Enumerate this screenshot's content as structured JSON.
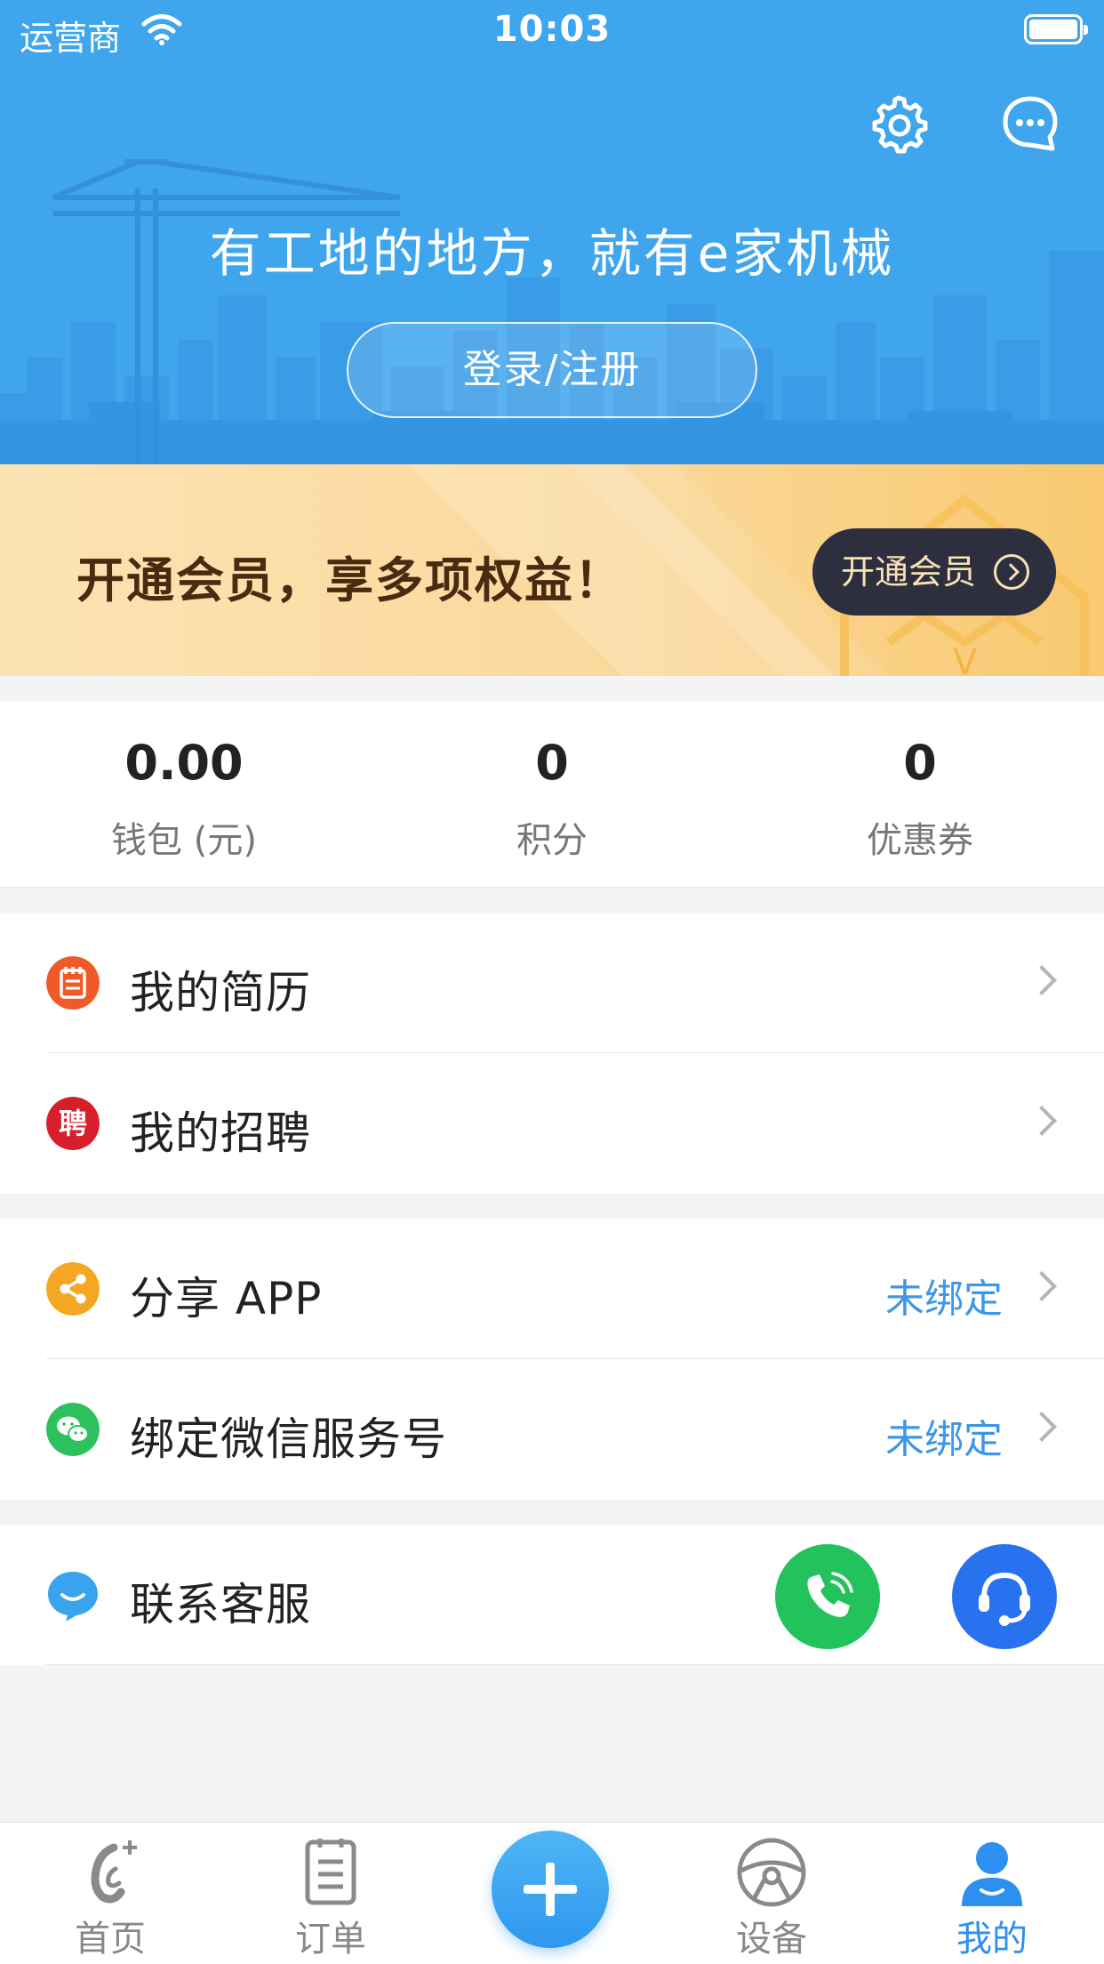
{
  "status_bar": {
    "carrier": "运营商",
    "time": "10:03"
  },
  "header": {
    "slogan": "有工地的地方，就有e家机械",
    "login_label": "登录/注册",
    "settings_icon": "gear-icon",
    "message_icon": "chat-bubble-icon",
    "background_color": "#3fa6ee"
  },
  "member": {
    "text": "开通会员，享多项权益！",
    "button_label": "开通会员"
  },
  "stats": [
    {
      "value": "0.00",
      "label": "钱包 (元)"
    },
    {
      "value": "0",
      "label": "积分"
    },
    {
      "value": "0",
      "label": "优惠券"
    }
  ],
  "menu_group_1": [
    {
      "label": "我的简历",
      "icon": "resume-icon"
    },
    {
      "label": "我的招聘",
      "icon": "recruit-icon",
      "icon_char": "聘"
    }
  ],
  "menu_group_2": [
    {
      "label": "分享 APP",
      "status": "未绑定",
      "icon": "share-icon"
    },
    {
      "label": "绑定微信服务号",
      "status": "未绑定",
      "icon": "wechat-icon"
    }
  ],
  "contact": {
    "label": "联系客服",
    "call_icon": "phone-icon",
    "service_icon": "headset-icon"
  },
  "tabs": [
    {
      "label": "首页",
      "icon": "home-logo-icon"
    },
    {
      "label": "订单",
      "icon": "order-icon"
    },
    {
      "label": "",
      "icon": "plus-icon"
    },
    {
      "label": "设备",
      "icon": "steering-wheel-icon"
    },
    {
      "label": "我的",
      "icon": "user-icon",
      "active": true
    }
  ],
  "colors": {
    "accent": "#2d8ff0",
    "status_blue": "#3c97e6",
    "call_green": "#22c25c",
    "service_blue": "#2872ef"
  }
}
